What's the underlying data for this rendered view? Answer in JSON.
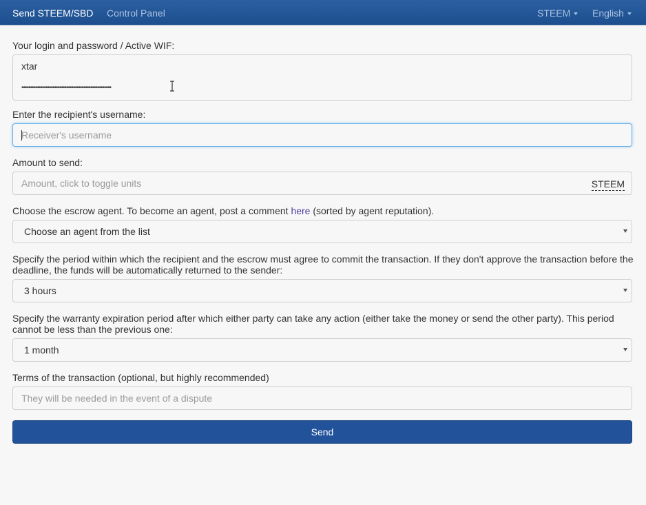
{
  "navbar": {
    "brand": "Send STEEM/SBD",
    "control_panel": "Control Panel",
    "currency": "STEEM",
    "language": "English"
  },
  "login": {
    "label": "Your login and password / Active WIF:",
    "username_value": "xtar",
    "password_value": "••••••••••••••••••••••••••••••••••••••••••••••••••••"
  },
  "recipient": {
    "label": "Enter the recipient's username:",
    "placeholder": "Receiver's username"
  },
  "amount": {
    "label": "Amount to send:",
    "placeholder": "Amount, click to toggle units",
    "unit": "STEEM"
  },
  "agent": {
    "label_before": "Choose the escrow agent. To become an agent, post a comment",
    "link": "here",
    "label_after": "(sorted by agent reputation).",
    "selected": "Choose an agent from the list"
  },
  "deadline": {
    "label": "Specify the period within which the recipient and the escrow must agree to commit the transaction. If they don't approve the transaction before the deadline, the funds will be automatically returned to the sender:",
    "selected": "3 hours"
  },
  "expiration": {
    "label": "Specify the warranty expiration period after which either party can take any action (either take the money or send the other party). This period cannot be less than the previous one:",
    "selected": "1 month"
  },
  "terms": {
    "label": "Terms of the transaction (optional, but highly recommended)",
    "placeholder": "They will be needed in the event of a dispute"
  },
  "send_button": "Send",
  "colors": {
    "navbar": "#245799",
    "primary_button": "#22529a",
    "focus_border": "#66afe9",
    "link": "#4d3a9e"
  }
}
